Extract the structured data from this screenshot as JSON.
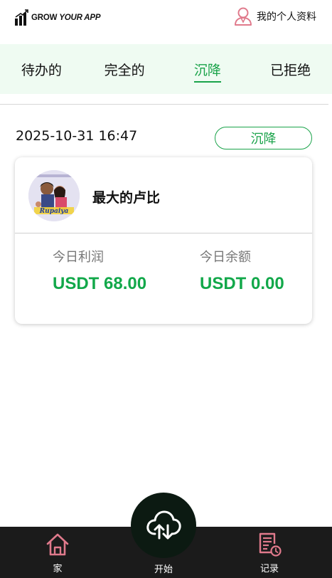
{
  "header": {
    "logo_bold": "GROW",
    "logo_italic": "YOUR APP",
    "profile_label": "我的个人资料",
    "profile_icon": "person-icon"
  },
  "tabs": [
    {
      "label": "待办的"
    },
    {
      "label": "完全的"
    },
    {
      "label": "沉降",
      "active": true
    },
    {
      "label": "已拒绝"
    }
  ],
  "record": {
    "datetime": "2025-10-31 16:47",
    "status": "沉降",
    "name": "最大的卢比",
    "avatar_caption": "Rupaiya",
    "stats": {
      "profit_label": "今日利润",
      "profit_value": "USDT 68.00",
      "balance_label": "今日余额",
      "balance_value": "USDT 0.00"
    }
  },
  "bottom_nav": {
    "home_label": "家",
    "start_label": "开始",
    "records_label": "记录",
    "home_icon": "home-icon",
    "start_icon": "cloud-sync-icon",
    "records_icon": "document-clock-icon"
  },
  "colors": {
    "accent_green": "#1aa34a",
    "tab_bar_bg": "#effbf2",
    "nav_bg": "#1b1b1b",
    "icon_pink": "#e07a8c"
  }
}
